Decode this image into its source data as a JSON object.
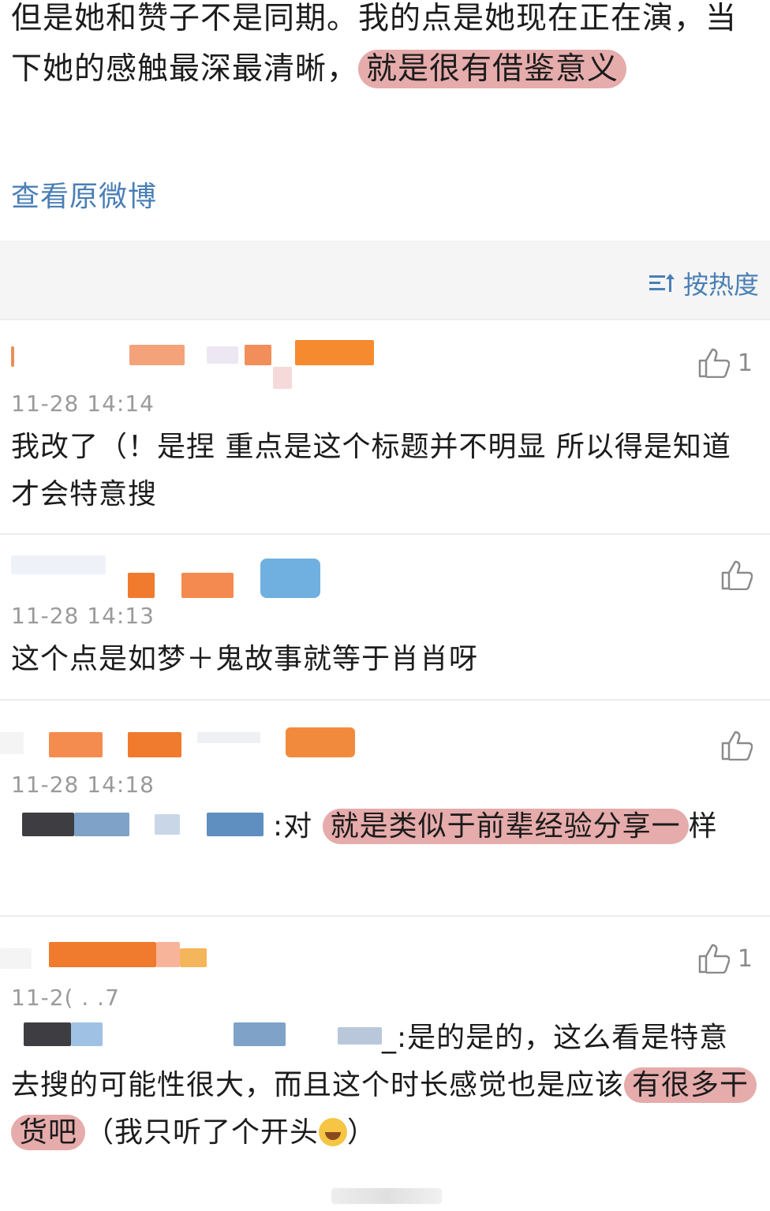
{
  "post": {
    "text_a": "但是她和赞子不是同期。我的点是她现在正在演，当下她的感触最深最清晰，",
    "text_highlight": "就是很有借鉴意义",
    "view_original": "查看原微博"
  },
  "sort": {
    "label": "按热度"
  },
  "comments": [
    {
      "time": "11-28 14:14",
      "likes": "1",
      "text": "我改了（！是捏 重点是这个标题并不明显 所以得是知道才会特意搜"
    },
    {
      "time": "11-28 14:13",
      "likes": "",
      "text": "这个点是如梦＋鬼故事就等于肖肖呀"
    },
    {
      "time": "11-28 14:18",
      "likes": "",
      "reply_prefix": ":对 ",
      "text_highlight": "就是类似于前辈经验分享一",
      "text_after": "样"
    },
    {
      "time": "11-2( .  .7",
      "likes": "1",
      "reply_prefix": "_:是的是的，这么看是特意去搜的可能性很大，而且这个时长感觉也是应该",
      "text_highlight": "有很多干货吧",
      "text_after": "（我只听了个开头",
      "text_end": "）"
    }
  ],
  "colors": {
    "link_blue": "#4a7fb5",
    "highlight": "#d67878",
    "time_gray": "#9a9a9a",
    "orange": "#f07a2e"
  },
  "icons": [
    "sort-icon",
    "thumbs-up-icon",
    "laughing-emoji-icon"
  ]
}
